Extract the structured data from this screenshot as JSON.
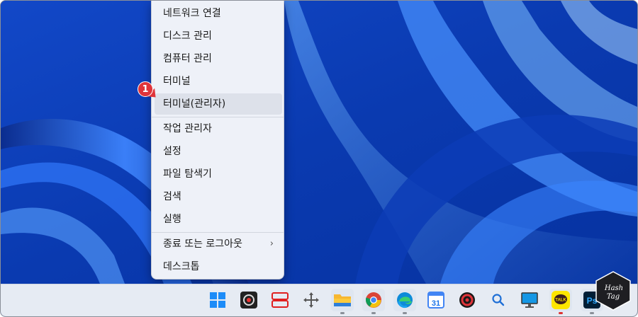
{
  "context_menu": {
    "items": [
      {
        "label": "네트워크 연결"
      },
      {
        "label": "디스크 관리"
      },
      {
        "label": "컴퓨터 관리"
      },
      {
        "label": "터미널"
      },
      {
        "label": "터미널(관리자)",
        "highlighted": true
      },
      {
        "label": "작업 관리자"
      },
      {
        "label": "설정"
      },
      {
        "label": "파일 탐색기"
      },
      {
        "label": "검색"
      },
      {
        "label": "실행"
      },
      {
        "label": "종료 또는 로그아웃",
        "submenu": true
      },
      {
        "label": "데스크톱"
      }
    ],
    "submenu_arrow": "›"
  },
  "annotation": {
    "step_number": "1"
  },
  "taskbar": {
    "icons": [
      {
        "name": "windows-start-icon"
      },
      {
        "name": "obs-icon"
      },
      {
        "name": "snip-tool-icon"
      },
      {
        "name": "move-icon"
      },
      {
        "name": "file-explorer-icon"
      },
      {
        "name": "chrome-icon"
      },
      {
        "name": "edge-icon"
      },
      {
        "name": "calendar-icon",
        "label": "31"
      },
      {
        "name": "davinci-icon"
      },
      {
        "name": "search-icon"
      },
      {
        "name": "monitor-icon"
      },
      {
        "name": "kakaotalk-icon",
        "label": "TALK"
      },
      {
        "name": "photoshop-icon",
        "label": "Ps"
      }
    ]
  },
  "watermark": {
    "line1": "Hash",
    "line2": "Tag"
  },
  "colors": {
    "accent": "#e0343a",
    "wallpaper": "#0a3aa8"
  }
}
